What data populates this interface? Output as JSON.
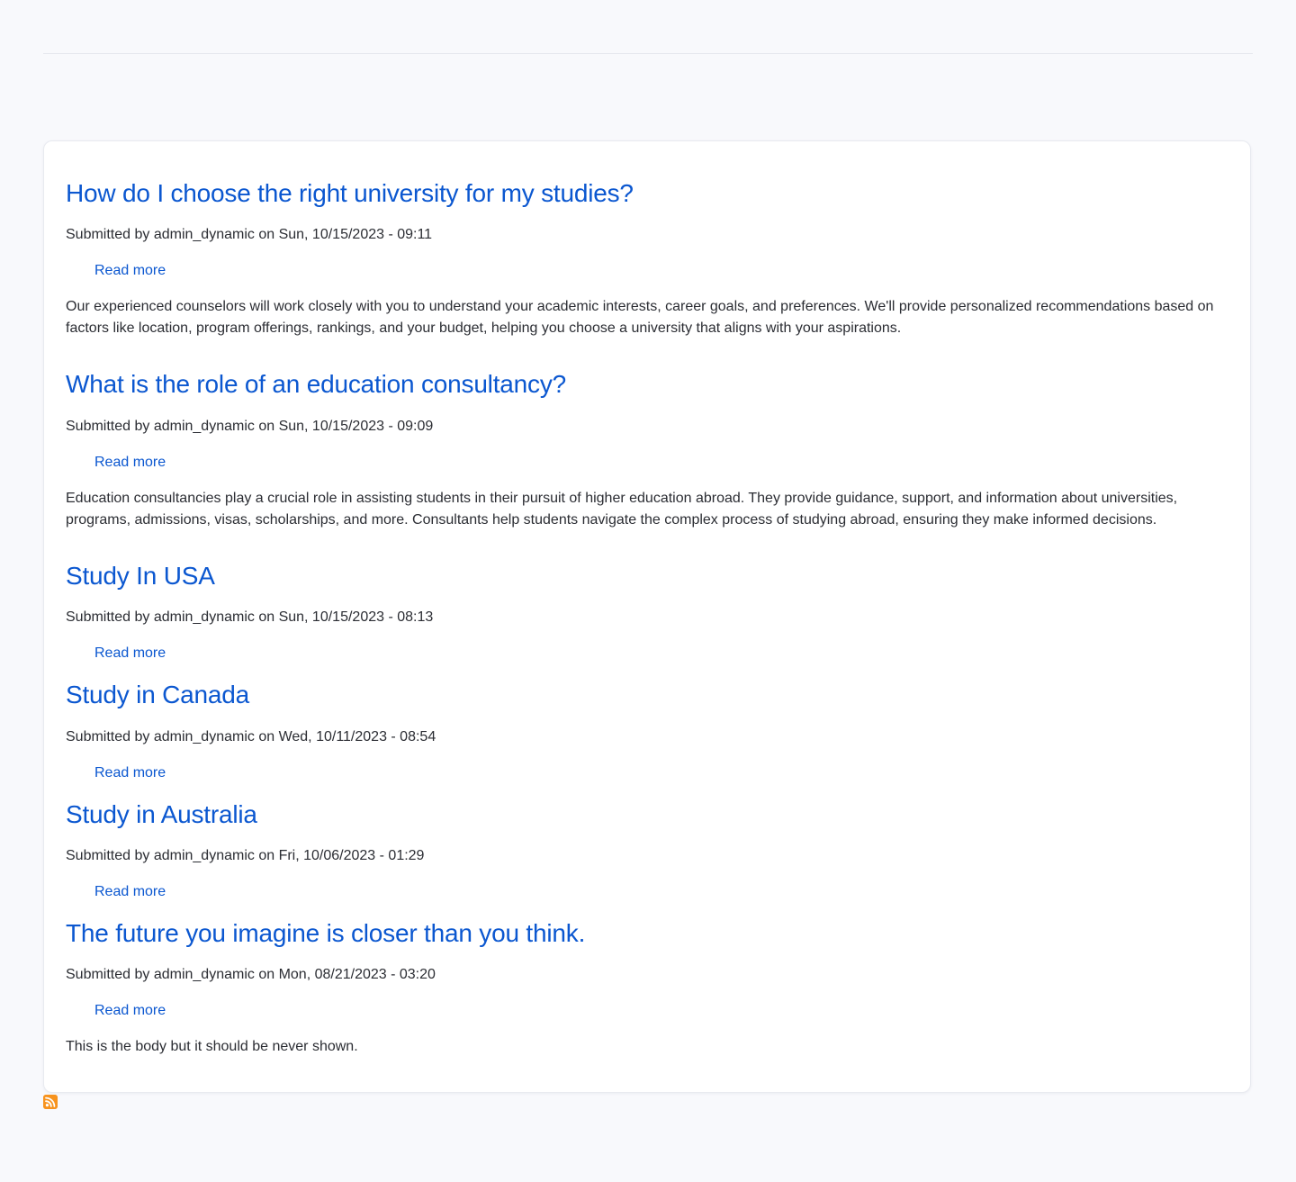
{
  "articles": [
    {
      "title": "How do I choose the right university for my studies?",
      "meta": "Submitted by admin_dynamic on Sun, 10/15/2023 - 09:11",
      "read_more": "Read more",
      "body": "Our experienced counselors will work closely with you to understand your academic interests, career goals, and preferences. We'll provide personalized recommendations based on factors like location, program offerings, rankings, and your budget, helping you choose a university that aligns with your aspirations."
    },
    {
      "title": "What is the role of an education consultancy?",
      "meta": "Submitted by admin_dynamic on Sun, 10/15/2023 - 09:09",
      "read_more": "Read more",
      "body": "Education consultancies play a crucial role in assisting students in their pursuit of higher education abroad. They provide guidance, support, and information about universities, programs, admissions, visas, scholarships, and more. Consultants help students navigate the complex process of studying abroad, ensuring they make informed decisions."
    },
    {
      "title": "Study In USA",
      "meta": "Submitted by admin_dynamic on Sun, 10/15/2023 - 08:13",
      "read_more": "Read more"
    },
    {
      "title": "Study in Canada",
      "meta": "Submitted by admin_dynamic on Wed, 10/11/2023 - 08:54",
      "read_more": "Read more"
    },
    {
      "title": "Study in Australia",
      "meta": "Submitted by admin_dynamic on Fri, 10/06/2023 - 01:29",
      "read_more": "Read more"
    },
    {
      "title": "The future you imagine is closer than you think.",
      "meta": "Submitted by admin_dynamic on Mon, 08/21/2023 - 03:20",
      "read_more": "Read more",
      "body": "This is the body but it should be never shown."
    }
  ],
  "feed": {
    "icon": "rss-feed-icon"
  },
  "colors": {
    "link": "#0b57d0",
    "page_background": "#f8f9fc",
    "card_background": "#ffffff",
    "rss": "#f7931e"
  }
}
